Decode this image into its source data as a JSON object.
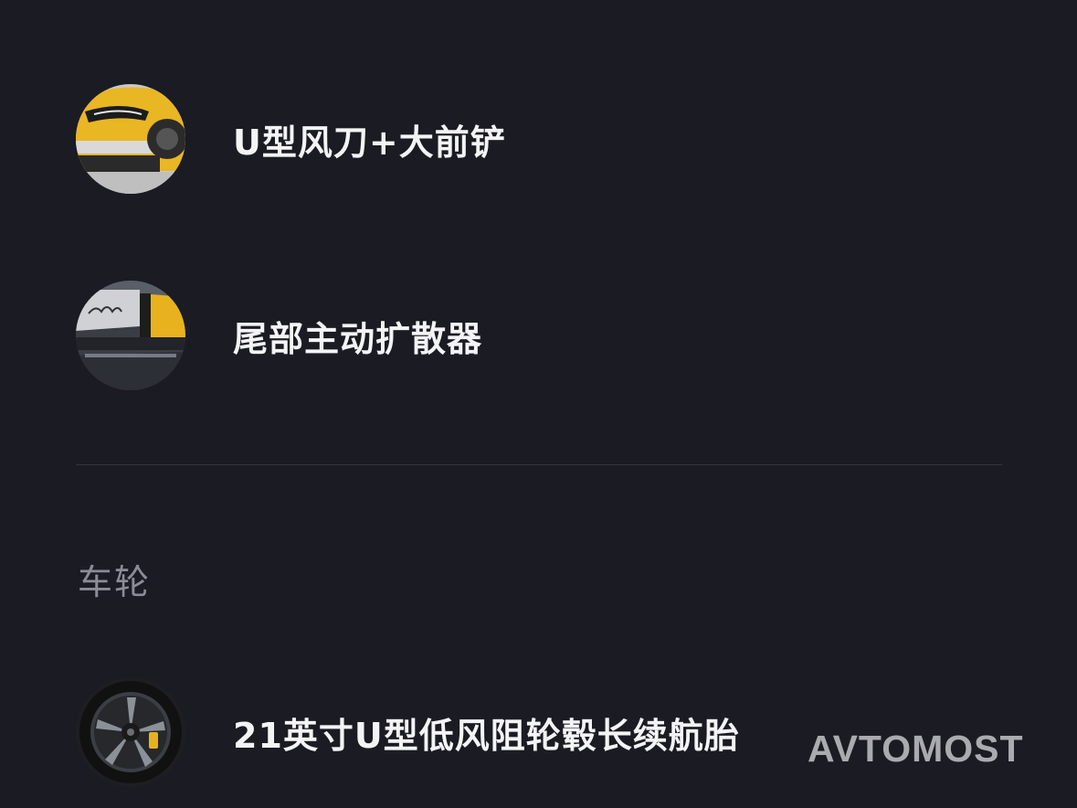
{
  "features": [
    {
      "label": "U型风刀+大前铲",
      "icon": "front-bumper-icon"
    },
    {
      "label": "尾部主动扩散器",
      "icon": "rear-diffuser-icon"
    }
  ],
  "wheels_section": {
    "title": "车轮",
    "items": [
      {
        "label": "21英寸U型低风阻轮毂长续航胎",
        "icon": "wheel-icon"
      }
    ]
  },
  "watermark": "AVTOMOST",
  "colors": {
    "background": "#1b1b23",
    "label_text": "#f4f4f6",
    "section_title": "#8a8c97",
    "divider": "#33333d",
    "car_accent": "#e8b21e"
  }
}
